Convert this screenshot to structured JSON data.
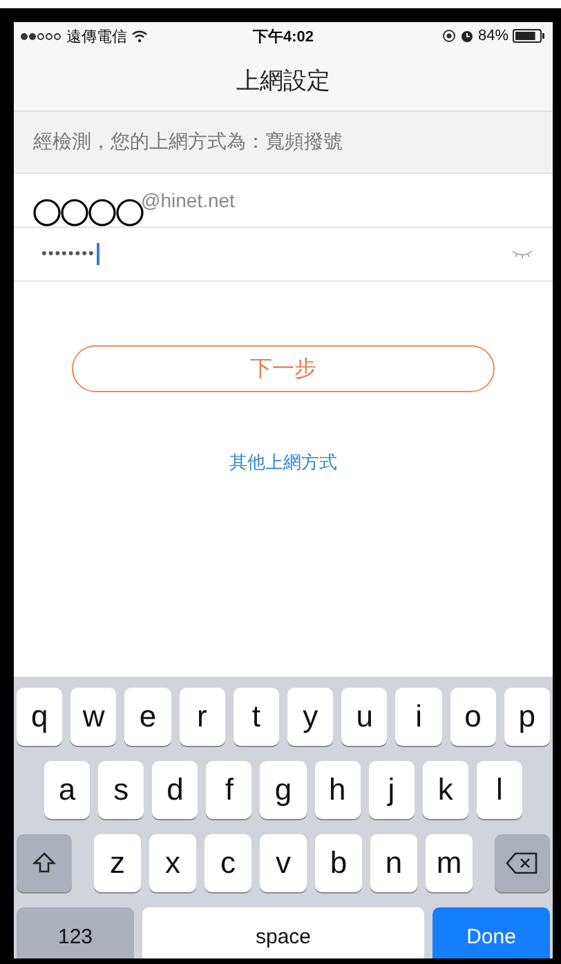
{
  "status_bar": {
    "signal_dots": [
      {
        "filled": true
      },
      {
        "filled": true
      },
      {
        "filled": false
      },
      {
        "filled": false
      },
      {
        "filled": false
      }
    ],
    "carrier": "遠傳電信",
    "time": "下午4:02",
    "battery_text": "84%"
  },
  "nav": {
    "title": "上網設定"
  },
  "notice": "經檢測，您的上網方式為：寬頻撥號",
  "fields": [
    {
      "kind": "email",
      "value": "@hinet.net",
      "redacted": true
    },
    {
      "kind": "password",
      "value": "••••••••",
      "focused": true
    }
  ],
  "next_button": "下一步",
  "other_link": "其他上網方式",
  "keyboard": {
    "rows": [
      [
        {
          "kind": "letter",
          "label": "q"
        },
        {
          "kind": "letter",
          "label": "w"
        },
        {
          "kind": "letter",
          "label": "e"
        },
        {
          "kind": "letter",
          "label": "r"
        },
        {
          "kind": "letter",
          "label": "t"
        },
        {
          "kind": "letter",
          "label": "y"
        },
        {
          "kind": "letter",
          "label": "u"
        },
        {
          "kind": "letter",
          "label": "i"
        },
        {
          "kind": "letter",
          "label": "o"
        },
        {
          "kind": "letter",
          "label": "p"
        }
      ],
      [
        {
          "kind": "letter",
          "label": "a"
        },
        {
          "kind": "letter",
          "label": "s"
        },
        {
          "kind": "letter",
          "label": "d"
        },
        {
          "kind": "letter",
          "label": "f"
        },
        {
          "kind": "letter",
          "label": "g"
        },
        {
          "kind": "letter",
          "label": "h"
        },
        {
          "kind": "letter",
          "label": "j"
        },
        {
          "kind": "letter",
          "label": "k"
        },
        {
          "kind": "letter",
          "label": "l"
        }
      ],
      [
        {
          "kind": "shift"
        },
        {
          "kind": "letter",
          "label": "z"
        },
        {
          "kind": "letter",
          "label": "x"
        },
        {
          "kind": "letter",
          "label": "c"
        },
        {
          "kind": "letter",
          "label": "v"
        },
        {
          "kind": "letter",
          "label": "b"
        },
        {
          "kind": "letter",
          "label": "n"
        },
        {
          "kind": "letter",
          "label": "m"
        },
        {
          "kind": "backspace"
        }
      ]
    ],
    "numbers_key": "123",
    "space_key": "space",
    "done_key": "Done"
  }
}
